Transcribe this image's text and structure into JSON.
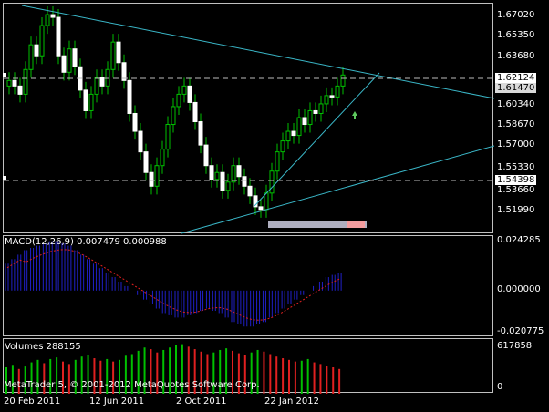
{
  "price_axis": [
    "1.67020",
    "1.65350",
    "1.63680",
    "1.60340",
    "1.58670",
    "1.57000",
    "1.55330",
    "1.53660",
    "1.51990"
  ],
  "price_tags": {
    "bid": "1.62124",
    "last": "1.61470",
    "hline": "1.54398"
  },
  "macd": {
    "title": "MACD(12,26,9) 0.007479 0.000988",
    "axis": [
      "0.024285",
      "0.000000",
      "-0.020775"
    ]
  },
  "volumes": {
    "title": "Volumes 288155",
    "axis": [
      "617858",
      "0"
    ]
  },
  "copyright": "MetaTrader 5, © 2001-2012 MetaQuotes Software Corp.",
  "dates": [
    "20 Feb 2011",
    "12 Jun 2011",
    "2 Oct 2011",
    "22 Jan 2012"
  ],
  "chart_data": {
    "type": "candlestick",
    "series": [
      {
        "name": "price",
        "values": [
          1.622,
          1.618,
          1.612,
          1.63,
          1.648,
          1.64,
          1.662,
          1.67,
          1.668,
          1.64,
          1.628,
          1.645,
          1.632,
          1.615,
          1.6,
          1.612,
          1.624,
          1.618,
          1.63,
          1.65,
          1.635,
          1.622,
          1.598,
          1.585,
          1.57,
          1.555,
          1.545,
          1.56,
          1.572,
          1.59,
          1.603,
          1.612,
          1.618,
          1.606,
          1.592,
          1.575,
          1.56,
          1.55,
          1.555,
          1.542,
          1.548,
          1.56,
          1.552,
          1.545,
          1.538,
          1.53,
          1.528,
          1.54,
          1.556,
          1.57,
          1.578,
          1.585,
          1.582,
          1.595,
          1.59,
          1.6,
          1.598,
          1.605,
          1.611,
          1.61,
          1.618,
          1.626
        ]
      },
      {
        "name": "macd_histogram",
        "values": [
          0.012,
          0.014,
          0.016,
          0.018,
          0.019,
          0.02,
          0.021,
          0.022,
          0.022,
          0.021,
          0.02,
          0.018,
          0.016,
          0.014,
          0.012,
          0.01,
          0.008,
          0.006,
          0.004,
          0.002,
          0.0,
          -0.002,
          -0.004,
          -0.006,
          -0.008,
          -0.01,
          -0.011,
          -0.012,
          -0.012,
          -0.011,
          -0.01,
          -0.009,
          -0.008,
          -0.009,
          -0.01,
          -0.012,
          -0.014,
          -0.015,
          -0.016,
          -0.016,
          -0.015,
          -0.014,
          -0.012,
          -0.01,
          -0.008,
          -0.006,
          -0.004,
          -0.002,
          0.0,
          0.002,
          0.004,
          0.006,
          0.007,
          0.008
        ]
      },
      {
        "name": "volume",
        "values": [
          320000,
          350000,
          300000,
          330000,
          380000,
          410000,
          370000,
          420000,
          440000,
          390000,
          360000,
          410000,
          450000,
          470000,
          430000,
          400000,
          420000,
          390000,
          410000,
          460000,
          480000,
          520000,
          560000,
          540000,
          500000,
          530000,
          560000,
          590000,
          600000,
          570000,
          540000,
          510000,
          480000,
          500000,
          530000,
          550000,
          520000,
          490000,
          470000,
          500000,
          530000,
          510000,
          480000,
          450000,
          430000,
          410000,
          390000,
          400000,
          420000,
          380000,
          360000,
          340000,
          320000,
          300000
        ]
      }
    ]
  }
}
